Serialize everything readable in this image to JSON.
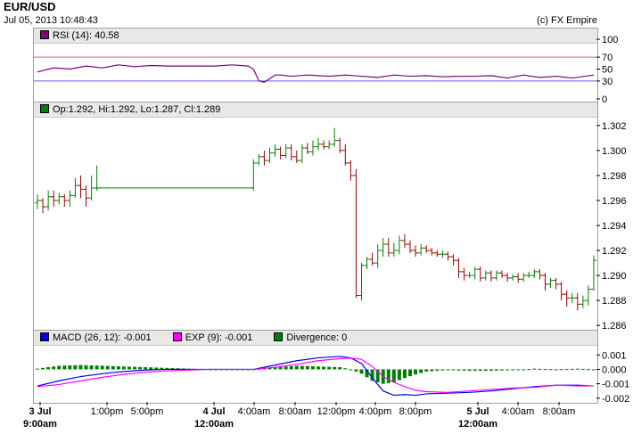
{
  "header": {
    "title": "EUR/USD",
    "timestamp": "Jul 05, 2013 10:48:43",
    "copyright": "(c) FX Empire"
  },
  "rsi_panel": {
    "legend": "RSI (14): 40.58",
    "color": "#800080",
    "ticks": [
      "100",
      "70",
      "50",
      "30",
      "0"
    ],
    "tick_values": [
      100,
      70,
      50,
      30,
      0
    ],
    "overbought": 70,
    "oversold": 30,
    "overbought_color": "#e06060",
    "oversold_color": "#6060e0"
  },
  "price_panel": {
    "legend": "Op:1.292, Hi:1.292, Lo:1.287, Cl:1.289",
    "color": "#008000",
    "ticks": [
      "1.302",
      "1.300",
      "1.298",
      "1.296",
      "1.294",
      "1.292",
      "1.290",
      "1.288",
      "1.286"
    ],
    "up_color": "#008000",
    "down_color": "#990000"
  },
  "macd_panel": {
    "legend_macd": "MACD (26, 12): -0.001",
    "legend_exp": "EXP (9): -0.001",
    "legend_div": "Divergence: 0",
    "macd_color": "#0000ff",
    "exp_color": "#ff00ff",
    "div_color": "#008000",
    "ticks": [
      "0.001",
      "0.000",
      "-0.001",
      "-0.002"
    ]
  },
  "x_axis": {
    "labels": [
      {
        "text": "3 Jul",
        "sub": "9:00am",
        "bold": true
      },
      {
        "text": "1:00pm"
      },
      {
        "text": "5:00pm"
      },
      {
        "text": "4 Jul",
        "sub": "12:00am",
        "bold": true
      },
      {
        "text": "4:00am"
      },
      {
        "text": "8:00am"
      },
      {
        "text": "12:00pm"
      },
      {
        "text": "4:00pm"
      },
      {
        "text": "8:00pm"
      },
      {
        "text": "5 Jul",
        "sub": "12:00am",
        "bold": true
      },
      {
        "text": "4:00am"
      },
      {
        "text": "8:00am"
      }
    ]
  },
  "chart_data": [
    {
      "type": "line",
      "title": "RSI (14): 40.58",
      "ylim": [
        0,
        100
      ],
      "levels": [
        70,
        30
      ],
      "x": [
        0,
        3,
        6,
        9,
        12,
        15,
        18,
        21,
        24,
        27,
        30,
        33,
        36,
        39,
        40,
        41,
        42,
        44,
        45,
        47,
        50,
        52,
        54,
        57,
        60,
        63,
        66,
        69,
        72,
        75,
        78,
        81,
        84,
        87,
        90,
        93,
        96,
        99,
        103
      ],
      "values": [
        45,
        52,
        50,
        55,
        52,
        57,
        54,
        56,
        55,
        55,
        55,
        55,
        57,
        55,
        50,
        30,
        28,
        40,
        40,
        38,
        40,
        39,
        38,
        40,
        38,
        36,
        40,
        38,
        39,
        37,
        38,
        38,
        39,
        35,
        40,
        36,
        38,
        35,
        40
      ]
    },
    {
      "type": "candlestick",
      "title": "Op:1.292, Hi:1.292, Lo:1.287, Cl:1.289",
      "ylim": [
        1.2858,
        1.3027
      ],
      "x": [
        0,
        1,
        2,
        3,
        4,
        5,
        6,
        7,
        8,
        9,
        10,
        11,
        40,
        41,
        42,
        43,
        44,
        45,
        46,
        47,
        48,
        49,
        50,
        51,
        52,
        53,
        54,
        55,
        56,
        57,
        58,
        59,
        60,
        61,
        62,
        63,
        64,
        65,
        66,
        67,
        68,
        69,
        70,
        71,
        72,
        73,
        74,
        75,
        76,
        77,
        78,
        79,
        80,
        81,
        82,
        83,
        84,
        85,
        86,
        87,
        88,
        89,
        90,
        91,
        92,
        93,
        94,
        95,
        96,
        97,
        98,
        99,
        100,
        101,
        102,
        103
      ],
      "open": [
        1.2958,
        1.296,
        1.2955,
        1.2963,
        1.296,
        1.2963,
        1.296,
        1.2964,
        1.2972,
        1.2969,
        1.2962,
        1.297,
        1.297,
        1.299,
        1.2995,
        1.2992,
        1.2998,
        1.3001,
        1.2996,
        1.3002,
        1.2995,
        1.2992,
        1.3002,
        1.2999,
        1.3003,
        1.3005,
        1.3003,
        1.3005,
        1.3008,
        1.3,
        1.299,
        1.298,
        1.2884,
        1.2908,
        1.2913,
        1.291,
        1.292,
        1.2925,
        1.2918,
        1.292,
        1.2928,
        1.2925,
        1.292,
        1.2918,
        1.2922,
        1.292,
        1.2918,
        1.2917,
        1.2917,
        1.2915,
        1.2912,
        1.2903,
        1.29,
        1.29,
        1.2905,
        1.2898,
        1.2902,
        1.2898,
        1.2902,
        1.29,
        1.2898,
        1.2899,
        1.2897,
        1.29,
        1.29,
        1.2903,
        1.29,
        1.2893,
        1.2896,
        1.2893,
        1.2885,
        1.2882,
        1.2882,
        1.2877,
        1.288,
        1.2889
      ],
      "close": [
        1.296,
        1.2955,
        1.2963,
        1.296,
        1.2963,
        1.296,
        1.2964,
        1.2972,
        1.2969,
        1.2962,
        1.297,
        1.297,
        1.299,
        1.2995,
        1.2992,
        1.2998,
        1.3001,
        1.2996,
        1.3002,
        1.2995,
        1.2992,
        1.3002,
        1.2999,
        1.3003,
        1.3005,
        1.3003,
        1.3005,
        1.3008,
        1.3,
        1.299,
        1.298,
        1.2884,
        1.2908,
        1.2913,
        1.291,
        1.292,
        1.2925,
        1.2918,
        1.292,
        1.2928,
        1.2925,
        1.292,
        1.2918,
        1.2922,
        1.292,
        1.2918,
        1.2917,
        1.2917,
        1.2915,
        1.2912,
        1.2903,
        1.29,
        1.29,
        1.2905,
        1.2898,
        1.2902,
        1.2898,
        1.2902,
        1.29,
        1.2898,
        1.2899,
        1.2897,
        1.29,
        1.29,
        1.2903,
        1.29,
        1.2893,
        1.2896,
        1.2893,
        1.2885,
        1.2882,
        1.2882,
        1.2877,
        1.288,
        1.2889,
        1.2912
      ],
      "high": [
        1.2965,
        1.2962,
        1.2968,
        1.2968,
        1.2966,
        1.2965,
        1.2968,
        1.2978,
        1.298,
        1.2972,
        1.298,
        1.2988,
        1.2993,
        1.2997,
        1.3,
        1.3002,
        1.3005,
        1.3003,
        1.3005,
        1.3005,
        1.3,
        1.3005,
        1.3006,
        1.3008,
        1.301,
        1.3008,
        1.3008,
        1.3018,
        1.301,
        1.3005,
        1.2992,
        1.2985,
        1.291,
        1.2915,
        1.2918,
        1.2925,
        1.293,
        1.293,
        1.2926,
        1.2932,
        1.2933,
        1.2928,
        1.2924,
        1.2925,
        1.2924,
        1.2922,
        1.292,
        1.292,
        1.2919,
        1.2917,
        1.2914,
        1.2906,
        1.2903,
        1.2907,
        1.2907,
        1.2904,
        1.2904,
        1.2904,
        1.2904,
        1.2902,
        1.2901,
        1.2902,
        1.2902,
        1.2903,
        1.2905,
        1.2905,
        1.2902,
        1.2898,
        1.2898,
        1.2895,
        1.2888,
        1.2886,
        1.2886,
        1.2884,
        1.2892,
        1.2916
      ],
      "low": [
        1.2953,
        1.295,
        1.2952,
        1.2955,
        1.2957,
        1.2955,
        1.2955,
        1.2962,
        1.2962,
        1.2955,
        1.296,
        1.2968,
        1.2968,
        1.2988,
        1.2988,
        1.299,
        1.2995,
        1.2993,
        1.2994,
        1.2992,
        1.299,
        1.299,
        1.2997,
        1.2996,
        1.3,
        1.3001,
        1.3001,
        1.3003,
        1.2998,
        1.2988,
        1.2976,
        1.2882,
        1.288,
        1.2905,
        1.2908,
        1.2906,
        1.2915,
        1.2915,
        1.2915,
        1.2917,
        1.2922,
        1.2918,
        1.2915,
        1.2916,
        1.2918,
        1.2916,
        1.2915,
        1.2914,
        1.2912,
        1.2908,
        1.2898,
        1.2896,
        1.2898,
        1.2897,
        1.2895,
        1.2896,
        1.2895,
        1.2896,
        1.2898,
        1.2895,
        1.2896,
        1.2894,
        1.2895,
        1.2898,
        1.2898,
        1.2897,
        1.2888,
        1.289,
        1.2889,
        1.288,
        1.2875,
        1.2878,
        1.2872,
        1.2874,
        1.2876,
        1.2888
      ]
    },
    {
      "type": "line",
      "title": "MACD (26, 12): -0.001",
      "ylim": [
        -0.0022,
        0.0017
      ],
      "x": [
        0,
        4,
        8,
        12,
        16,
        20,
        24,
        28,
        32,
        36,
        40,
        44,
        48,
        52,
        56,
        58,
        60,
        62,
        64,
        66,
        68,
        70,
        72,
        76,
        80,
        84,
        88,
        92,
        96,
        100,
        103
      ],
      "series": [
        {
          "name": "MACD (26, 12): -0.001",
          "color": "#0000ff",
          "values": [
            -0.00115,
            -0.0008,
            -0.0005,
            -0.0003,
            -0.00015,
            -5e-05,
            0.0,
            0.0,
            0.0,
            0.0,
            0.0,
            0.0003,
            0.0006,
            0.0008,
            0.0009,
            0.0008,
            0.0004,
            -0.0006,
            -0.0015,
            -0.0018,
            -0.00175,
            -0.0018,
            -0.0017,
            -0.00165,
            -0.0016,
            -0.0015,
            -0.00135,
            -0.0012,
            -0.0011,
            -0.0011,
            -0.00115
          ]
        },
        {
          "name": "EXP (9): -0.001",
          "color": "#ff00ff",
          "values": [
            -0.0012,
            -0.00105,
            -0.0008,
            -0.00055,
            -0.00035,
            -0.0002,
            -0.0001,
            -5e-05,
            0.0,
            0.0,
            0.0,
            0.00015,
            0.00035,
            0.0006,
            0.00075,
            0.00078,
            0.0007,
            0.0002,
            -0.0005,
            -0.0009,
            -0.0012,
            -0.00145,
            -0.00155,
            -0.0016,
            -0.0015,
            -0.0014,
            -0.0013,
            -0.00125,
            -0.0011,
            -0.00115,
            -0.00115
          ]
        },
        {
          "name": "Divergence: 0",
          "color": "#008000",
          "type": "bar",
          "values": [
            5e-05,
            0.00025,
            0.0003,
            0.00025,
            0.0002,
            0.00015,
            0.0001,
            5e-05,
            0.0,
            0.0,
            0.0,
            0.00015,
            0.00025,
            0.0002,
            0.00015,
            0.0,
            -0.0003,
            -0.0008,
            -0.001,
            -0.0009,
            -0.0006,
            -0.00035,
            -0.00015,
            -5e-05,
            -0.0001,
            -0.0001,
            -5e-05,
            5e-05,
            0.0,
            5e-05,
            0.0
          ]
        }
      ]
    }
  ]
}
